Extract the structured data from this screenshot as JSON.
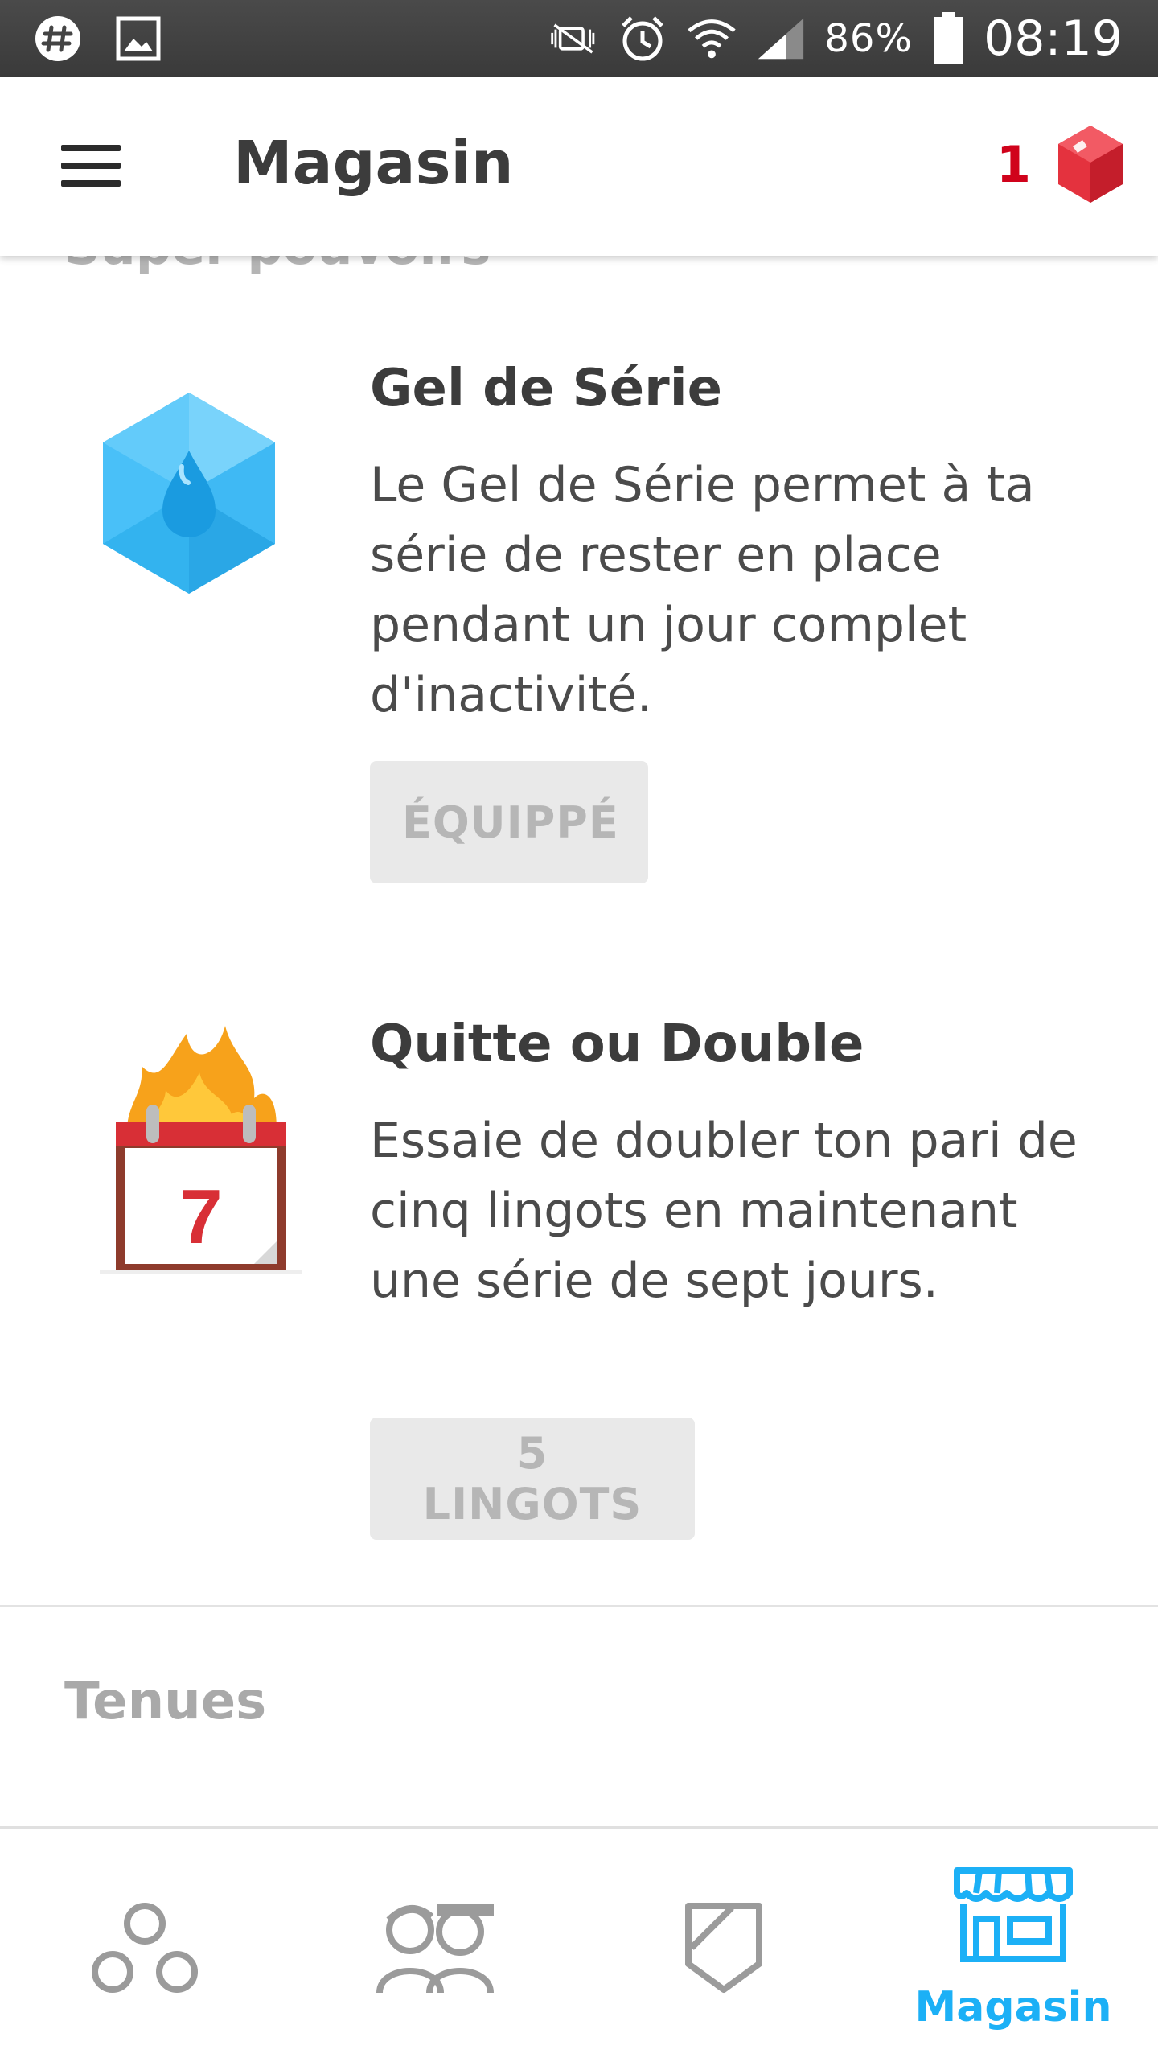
{
  "status_bar": {
    "battery": "86%",
    "time": "08:19",
    "icons": [
      "slack-icon",
      "image-icon",
      "mute-icon",
      "alarm-icon",
      "wifi-icon",
      "signal-icon",
      "battery-icon"
    ]
  },
  "app_bar": {
    "title": "Magasin",
    "gem_count": "1"
  },
  "content": {
    "section_peek": "Super pouvoirs",
    "items": [
      {
        "title": "Gel de Série",
        "description": "Le Gel de Série permet à ta série de rester en place pendant un jour complet d'inactivité.",
        "button": "ÉQUIPPÉ",
        "icon": "streak-freeze-icon"
      },
      {
        "title": "Quitte ou Double",
        "description": "Essaie de doubler ton pari de cinq lingots en maintenant une série de sept jours.",
        "button": "5 LINGOTS",
        "icon": "double-or-nothing-icon",
        "calendar_number": "7"
      }
    ],
    "section_title": "Tenues"
  },
  "bottom_nav": {
    "items": [
      {
        "name": "learn",
        "icon": "circles-icon",
        "active": false
      },
      {
        "name": "friends",
        "icon": "friends-icon",
        "active": false
      },
      {
        "name": "clubs",
        "icon": "shield-icon",
        "active": false
      },
      {
        "name": "shop",
        "icon": "shop-icon",
        "label": "Magasin",
        "active": true
      }
    ]
  },
  "colors": {
    "accent": "#1cb0f6",
    "gem": "#d0021b",
    "button_bg": "#e9e9e9",
    "button_text": "#b6b6b6",
    "inactive_icon": "#9b9b9b"
  }
}
